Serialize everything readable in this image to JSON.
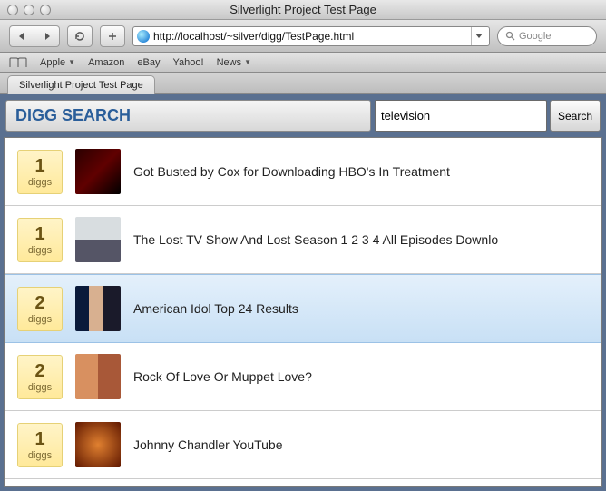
{
  "window": {
    "title": "Silverlight Project Test Page"
  },
  "toolbar": {
    "url": "http://localhost/~silver/digg/TestPage.html",
    "search_placeholder": "Google"
  },
  "bookmarks": {
    "items": [
      {
        "label": "Apple",
        "has_dropdown": true
      },
      {
        "label": "Amazon",
        "has_dropdown": false
      },
      {
        "label": "eBay",
        "has_dropdown": false
      },
      {
        "label": "Yahoo!",
        "has_dropdown": false
      },
      {
        "label": "News",
        "has_dropdown": true
      }
    ]
  },
  "tabs": {
    "active": {
      "label": "Silverlight Project Test Page"
    }
  },
  "app": {
    "title": "DIGG SEARCH",
    "search_value": "television",
    "search_button": "Search",
    "digg_label": "diggs",
    "results": [
      {
        "count": 1,
        "title": "Got Busted by Cox for Downloading HBO's In Treatment",
        "selected": false
      },
      {
        "count": 1,
        "title": "The Lost TV Show And Lost Season 1 2 3 4 All Episodes Downlo",
        "selected": false
      },
      {
        "count": 2,
        "title": "American Idol Top 24 Results",
        "selected": true
      },
      {
        "count": 2,
        "title": "Rock Of Love Or Muppet Love?",
        "selected": false
      },
      {
        "count": 1,
        "title": "Johnny Chandler YouTube",
        "selected": false
      }
    ]
  }
}
